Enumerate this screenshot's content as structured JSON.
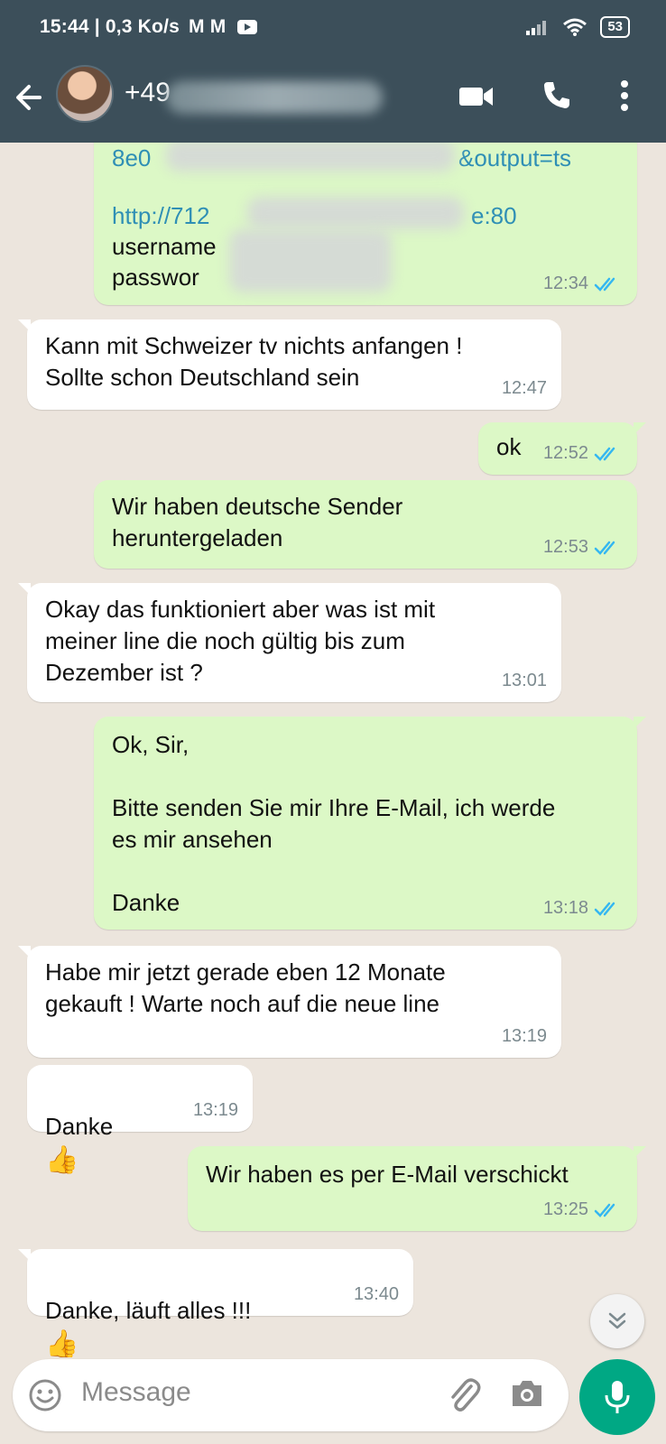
{
  "status_bar": {
    "time_speed": "15:44 | 0,3 Ko/s",
    "notif_icons": "M M",
    "battery": "53"
  },
  "header": {
    "contact": "+49"
  },
  "messages": [
    {
      "dir": "out",
      "lines": [
        "8e0",
        "&output=ts",
        "http://712",
        "e:80",
        "username",
        "passwor"
      ],
      "time": "12:34"
    },
    {
      "dir": "in",
      "text": "Kann mit Schweizer tv nichts anfangen !\nSollte schon Deutschland sein",
      "time": "12:47"
    },
    {
      "dir": "out",
      "text": "ok",
      "time": "12:52"
    },
    {
      "dir": "out",
      "text": "Wir haben deutsche Sender\nheruntergeladen",
      "time": "12:53"
    },
    {
      "dir": "in",
      "text": "Okay das funktioniert aber was ist mit\nmeiner line die noch gültig bis zum\nDezember ist ?",
      "time": "13:01"
    },
    {
      "dir": "out",
      "text": "Ok, Sir,\n\nBitte senden Sie mir Ihre E-Mail, ich werde\nes mir ansehen\n\nDanke",
      "time": "13:18"
    },
    {
      "dir": "in",
      "text": "Habe mir jetzt gerade eben 12 Monate\ngekauft ! Warte noch auf die neue line",
      "time": "13:19"
    },
    {
      "dir": "in",
      "text": "Danke",
      "time": "13:19",
      "emoji": "👍"
    },
    {
      "dir": "out",
      "text": "Wir haben es per E-Mail verschickt",
      "time": "13:25"
    },
    {
      "dir": "in",
      "text": "Danke, läuft alles !!!",
      "time": "13:40",
      "emoji": "👍"
    }
  ],
  "input": {
    "placeholder": "Message"
  },
  "colors": {
    "header": "#3c4f5a",
    "outgoing_bubble": "#dcf8c6",
    "incoming_bubble": "#ffffff",
    "chat_background": "#ece5dd",
    "read_ticks": "#34b7f1",
    "mic_button": "#00a884"
  },
  "icons": [
    "back-arrow-icon",
    "video-call-icon",
    "phone-icon",
    "more-vert-icon",
    "double-check-icon",
    "chevron-down-double-icon",
    "emoji-icon",
    "attach-icon",
    "camera-icon",
    "mic-icon"
  ]
}
